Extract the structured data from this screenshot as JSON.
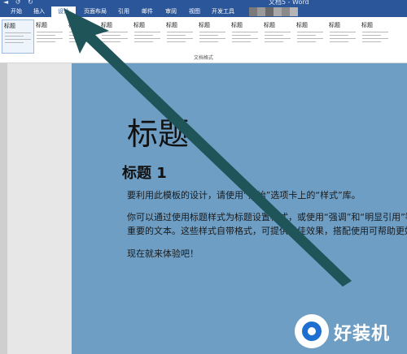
{
  "window": {
    "title": "文档5 - Word"
  },
  "tabs": [
    {
      "label": "开始"
    },
    {
      "label": "插入"
    },
    {
      "label": "设计"
    },
    {
      "label": "页面布局"
    },
    {
      "label": "引用"
    },
    {
      "label": "邮件"
    },
    {
      "label": "审阅"
    },
    {
      "label": "视图"
    },
    {
      "label": "开发工具"
    }
  ],
  "active_tab": "设计",
  "ribbon": {
    "group_label": "文档格式",
    "style_tiles": [
      "标题",
      "标题",
      "标题",
      "标题",
      "标题",
      "标题",
      "标题",
      "标题",
      "标题",
      "标题",
      "标题",
      "标题"
    ]
  },
  "document": {
    "title": "标题",
    "heading1": "标题 1",
    "paragraphs": [
      "要利用此模板的设计，请使用“开始”选项卡上的“样式”库。",
      "你可以通过使用标题样式为标题设置格式，或使用“强调”和“明显引用”等其他样式",
      "重要的文本。这些样式自带格式，可提供最佳效果，搭配使用可帮助更好地传达你",
      "现在就来体验吧！"
    ]
  },
  "watermark": {
    "text": "好装机"
  },
  "colors": {
    "ribbon_blue": "#2b579a",
    "page_highlight": "#6e9ec4",
    "arrow": "#1f5459"
  }
}
